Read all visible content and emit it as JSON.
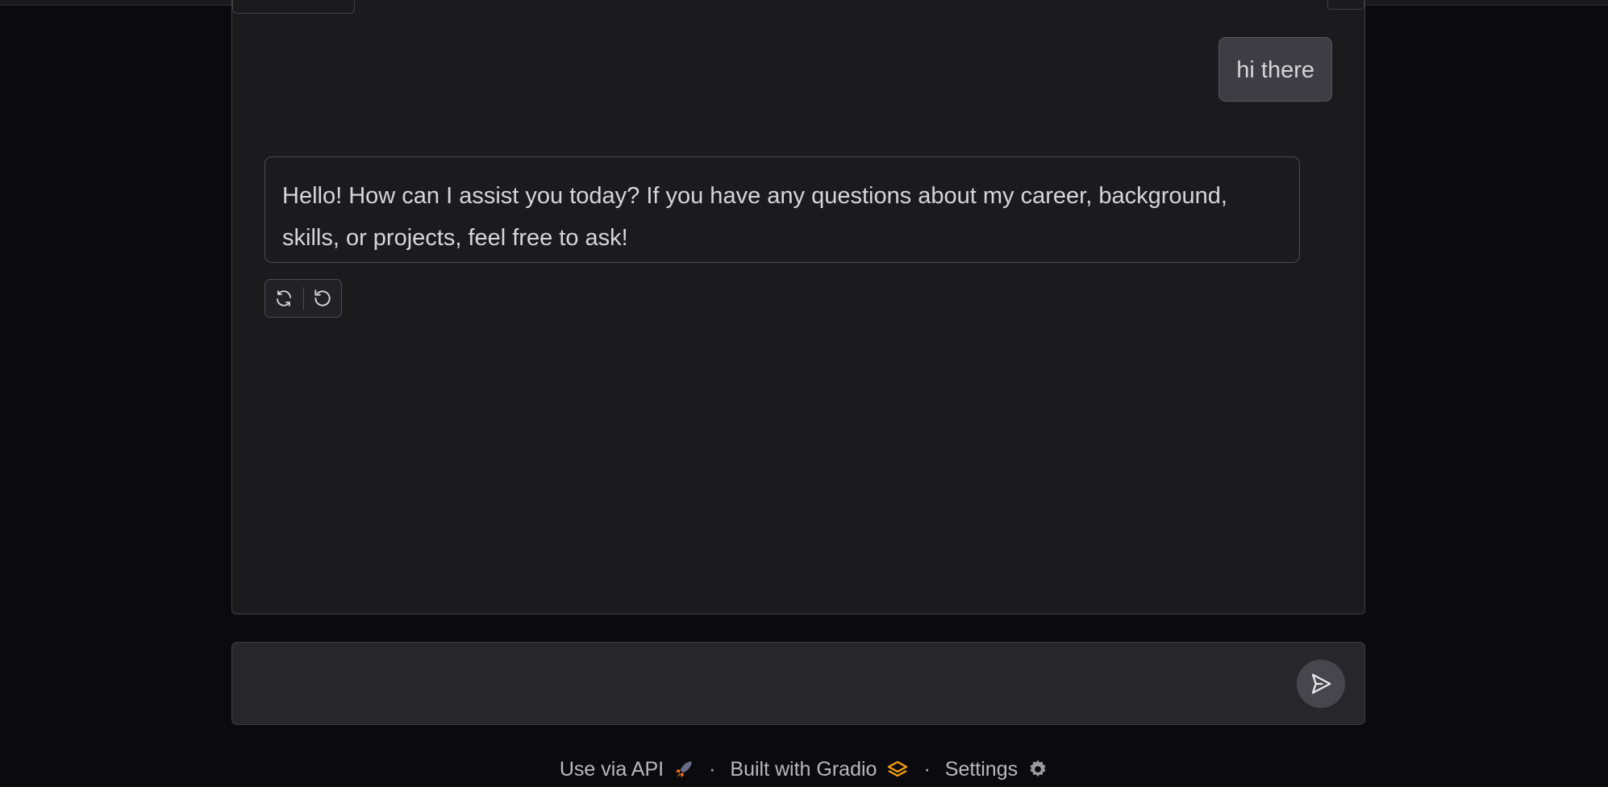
{
  "chat": {
    "user_message": "hi there",
    "bot_message": "Hello! How can I assist you today? If you have any questions about my career, background, skills, or projects, feel free to ask!"
  },
  "actions": {
    "retry_icon": "refresh-icon",
    "undo_icon": "undo-icon"
  },
  "input": {
    "value": "",
    "placeholder": ""
  },
  "footer": {
    "api_label": "Use via API",
    "gradio_label": "Built with Gradio",
    "settings_label": "Settings",
    "separator": "·"
  },
  "colors": {
    "accent_rocket": "#f97316",
    "gradio_logo": "#f59e0b"
  }
}
